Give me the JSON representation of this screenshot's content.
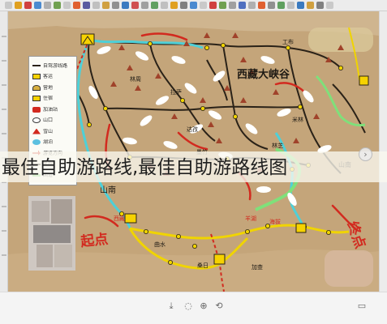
{
  "caption": {
    "title": "最佳自助游路线,最佳自助游路线图"
  },
  "map": {
    "big_labels": [
      "西藏大峡谷"
    ],
    "red_labels": [
      "起点",
      "终点",
      "山南"
    ],
    "place_labels": [
      "西藏",
      "山南",
      "拉萨",
      "林芝",
      "米林",
      "羊湖",
      "海拔",
      "达孜",
      "墨竹",
      "工布",
      "林周",
      "曲水",
      "桑日",
      "加查"
    ],
    "colors": {
      "map_background": "#c2a377",
      "yellow_route": "#f0d400",
      "cyan_route": "#4ed0d8",
      "green_route": "#7fe07a",
      "black_route": "#2a2218",
      "red_marker": "#d22a1f",
      "white_marker": "#ffffff"
    }
  },
  "legend": {
    "items": [
      {
        "icon": "route-line-icon",
        "label": "自驾游线路"
      },
      {
        "icon": "bus-icon",
        "label": "客运"
      },
      {
        "icon": "camp-icon",
        "label": "营地"
      },
      {
        "icon": "hotel-icon",
        "label": "住宿"
      },
      {
        "icon": "gas-icon",
        "label": "加油站"
      },
      {
        "icon": "pass-icon",
        "label": "山口"
      },
      {
        "icon": "peak-icon",
        "label": "雪山"
      },
      {
        "icon": "lake-icon",
        "label": "湖泊"
      },
      {
        "icon": "arrow-icon",
        "label": "游览方向"
      },
      {
        "icon": "distance-icon",
        "label": "里程"
      },
      {
        "icon": "road-icon",
        "label": "国道"
      }
    ]
  },
  "controls": {
    "next_glyph": "›",
    "bottom_icons": [
      "download-icon",
      "comment-icon",
      "zoom-icon",
      "share-icon",
      "fullscreen-icon"
    ]
  }
}
